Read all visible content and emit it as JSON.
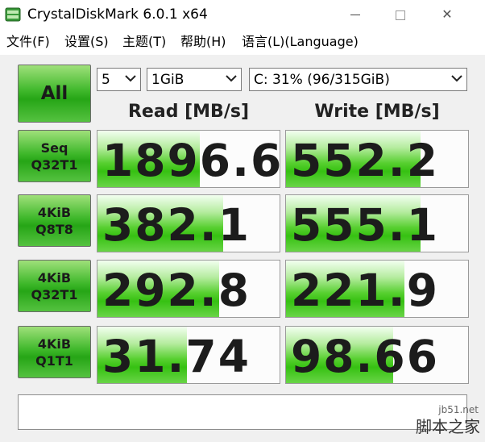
{
  "window": {
    "title": "CrystalDiskMark 6.0.1 x64",
    "minimize": "",
    "maximize": "",
    "close": "✕"
  },
  "menu": [
    {
      "label": "文件(F)"
    },
    {
      "label": "设置(S)"
    },
    {
      "label": "主题(T)"
    },
    {
      "label": "帮助(H)"
    },
    {
      "label": "语言(L)(Language)"
    }
  ],
  "controls": {
    "all_label": "All",
    "count_value": "5",
    "size_value": "1GiB",
    "drive_value": "C: 31% (96/315GiB)"
  },
  "headers": {
    "read": "Read [MB/s]",
    "write": "Write [MB/s]"
  },
  "tests": [
    {
      "line1": "Seq",
      "line2": "Q32T1",
      "read": "1896.6",
      "write": "552.2",
      "read_fill": 0.56,
      "write_fill": 0.74
    },
    {
      "line1": "4KiB",
      "line2": "Q8T8",
      "read": "382.1",
      "write": "555.1",
      "read_fill": 0.69,
      "write_fill": 0.74
    },
    {
      "line1": "4KiB",
      "line2": "Q32T1",
      "read": "292.8",
      "write": "221.9",
      "read_fill": 0.67,
      "write_fill": 0.65
    },
    {
      "line1": "4KiB",
      "line2": "Q1T1",
      "read": "31.74",
      "write": "98.66",
      "read_fill": 0.49,
      "write_fill": 0.59
    }
  ],
  "watermark": {
    "site": "jb51.net",
    "name": "脚本之家"
  },
  "colors": {
    "button_green": "#3fb82b",
    "bar_green": "#36c112",
    "client_bg": "#f0f0f0"
  }
}
